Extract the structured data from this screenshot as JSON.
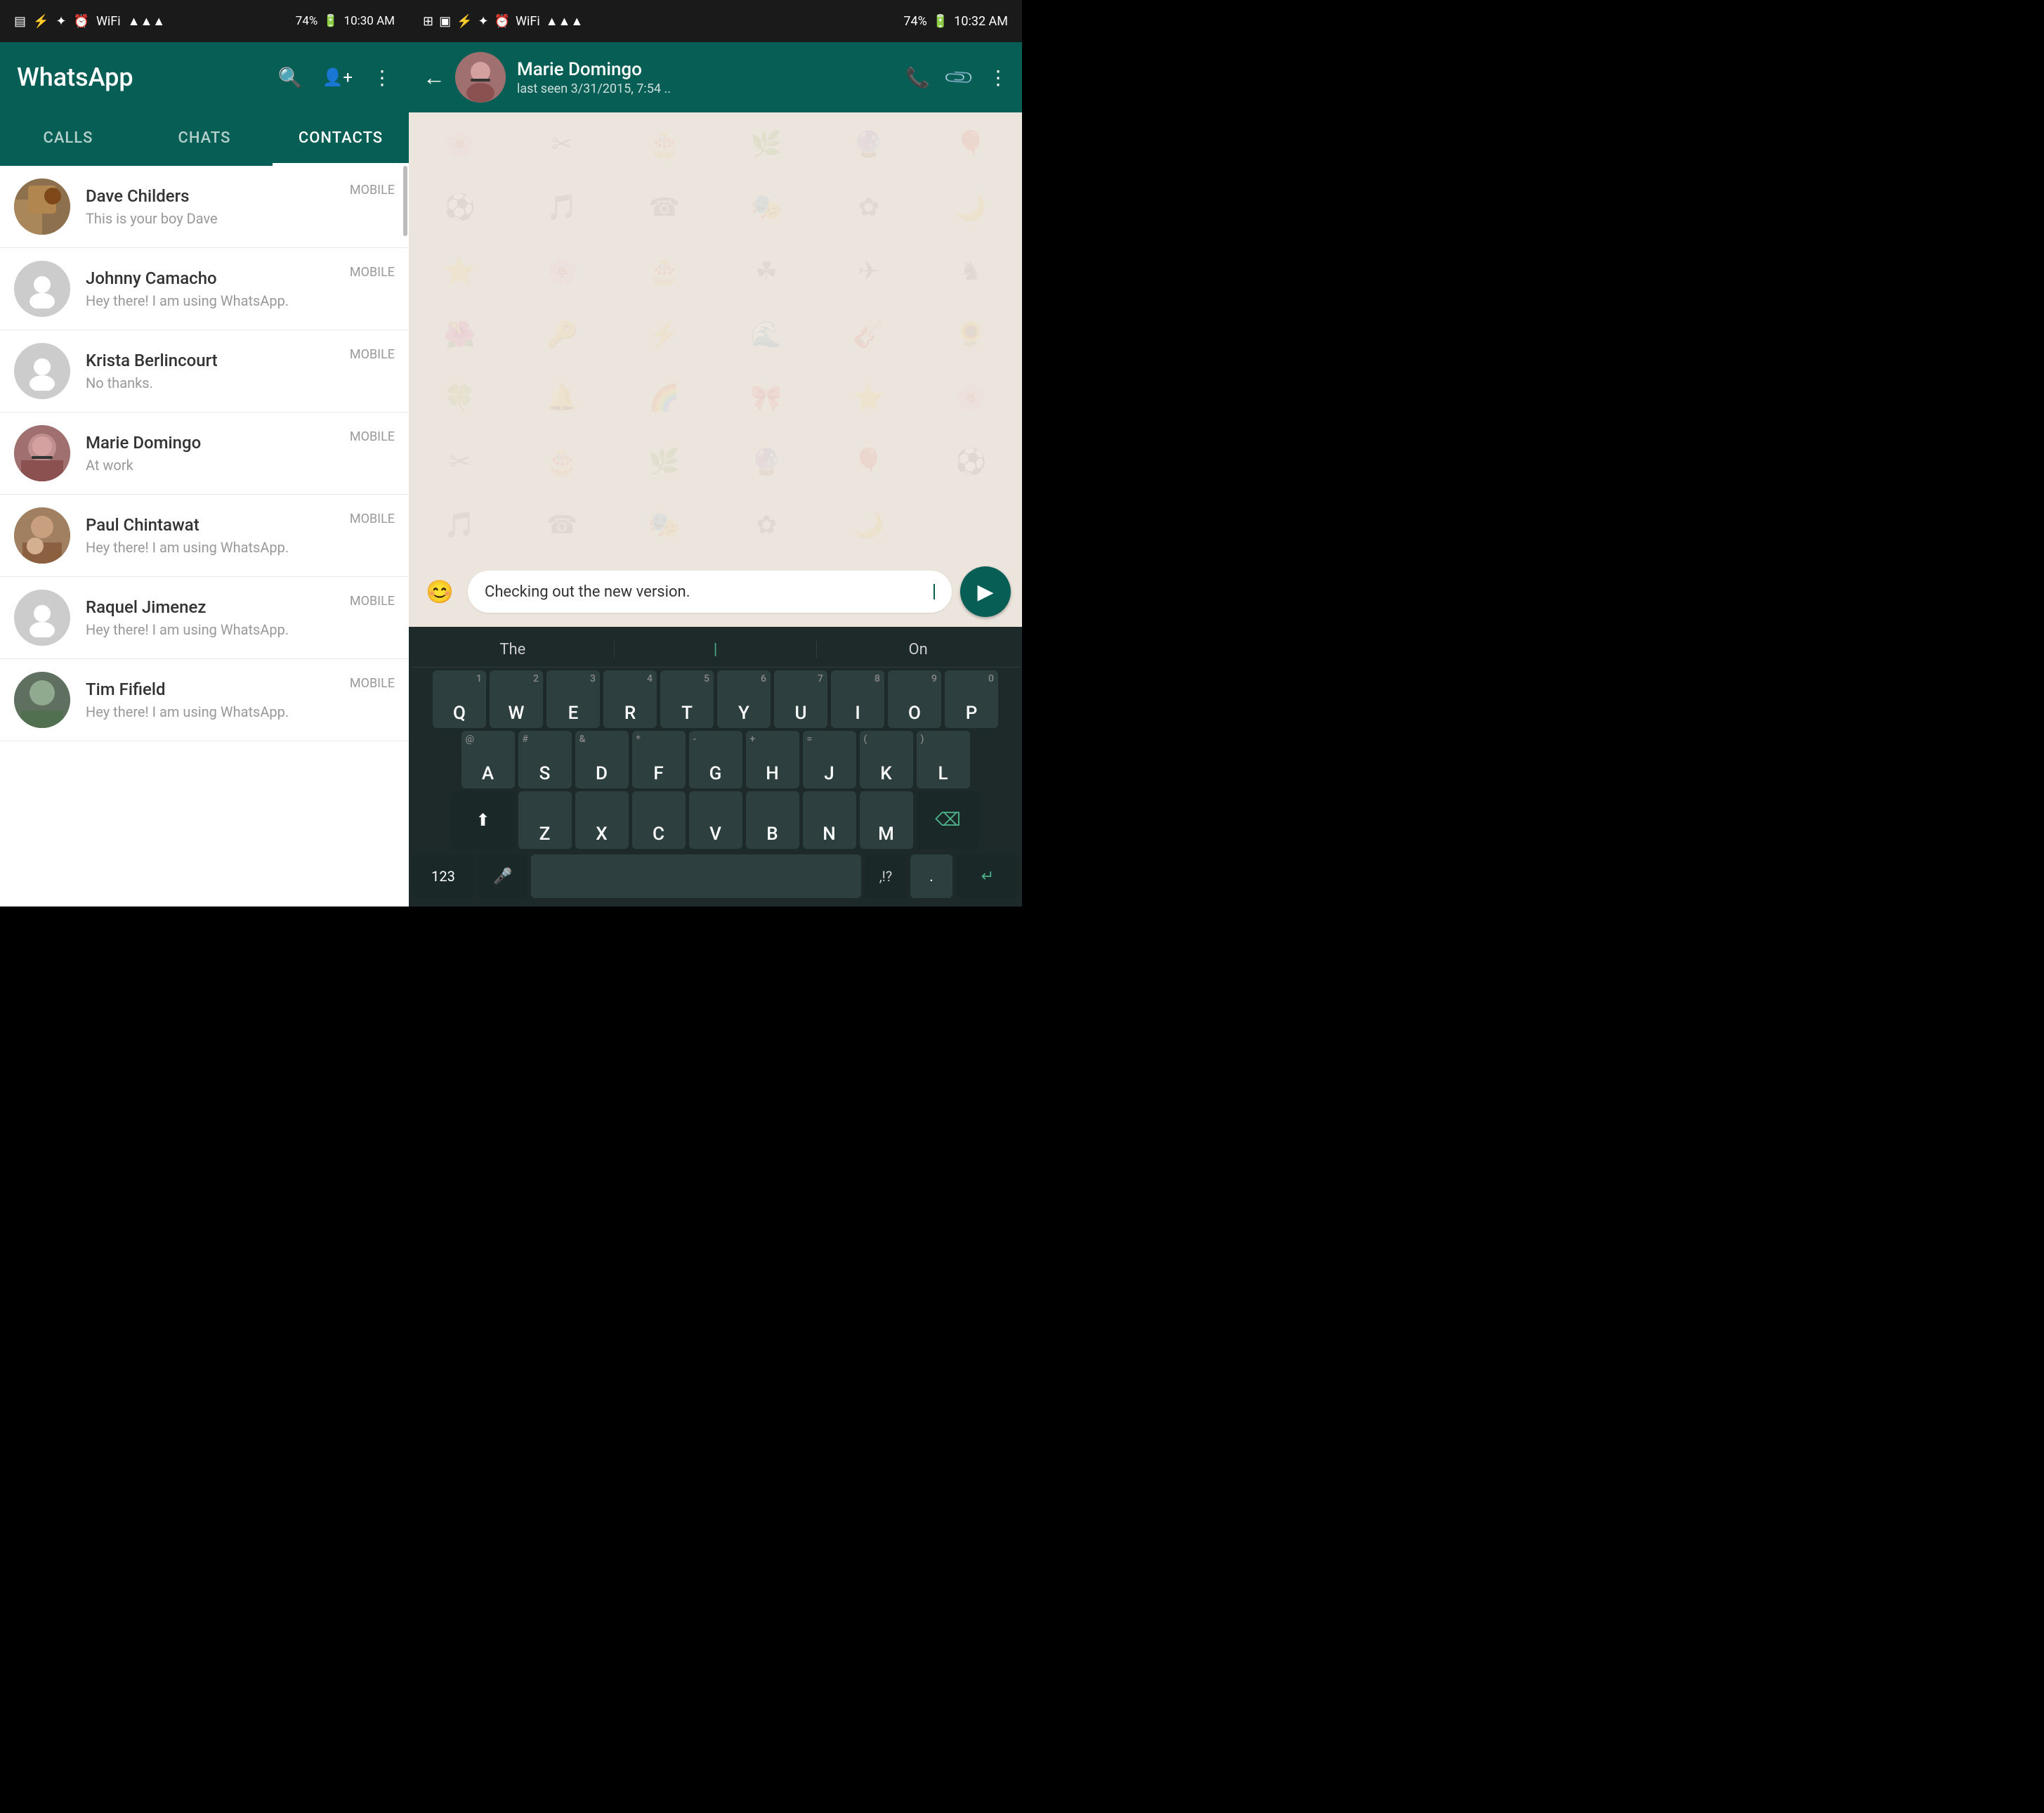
{
  "left": {
    "statusBar": {
      "time": "10:30 AM",
      "battery": "74%"
    },
    "header": {
      "title": "WhatsApp",
      "searchIcon": "🔍",
      "addContactIcon": "👤+",
      "menuIcon": "⋮"
    },
    "tabs": [
      {
        "id": "calls",
        "label": "CALLS",
        "active": false
      },
      {
        "id": "chats",
        "label": "CHATS",
        "active": false
      },
      {
        "id": "contacts",
        "label": "CONTACTS",
        "active": true
      }
    ],
    "contacts": [
      {
        "id": "dave",
        "name": "Dave Childers",
        "status": "This is your boy Dave",
        "type": "MOBILE",
        "hasPhoto": true
      },
      {
        "id": "johnny",
        "name": "Johnny Camacho",
        "status": "Hey there! I am using WhatsApp.",
        "type": "MOBILE",
        "hasPhoto": false
      },
      {
        "id": "krista",
        "name": "Krista Berlincourt",
        "status": "No thanks.",
        "type": "MOBILE",
        "hasPhoto": false
      },
      {
        "id": "marie",
        "name": "Marie Domingo",
        "status": "At work",
        "type": "MOBILE",
        "hasPhoto": true
      },
      {
        "id": "paul",
        "name": "Paul Chintawat",
        "status": "Hey there! I am using WhatsApp.",
        "type": "MOBILE",
        "hasPhoto": true
      },
      {
        "id": "raquel",
        "name": "Raquel Jimenez",
        "status": "Hey there! I am using WhatsApp.",
        "type": "MOBILE",
        "hasPhoto": false
      },
      {
        "id": "tim",
        "name": "Tim Fifield",
        "status": "Hey there! I am using WhatsApp.",
        "type": "MOBILE",
        "hasPhoto": true
      }
    ]
  },
  "right": {
    "statusBar": {
      "time": "10:32 AM",
      "battery": "74%"
    },
    "header": {
      "backIcon": "←",
      "contactName": "Marie Domingo",
      "lastSeen": "last seen 3/31/2015, 7:54 ..",
      "callIcon": "📞",
      "attachIcon": "📎",
      "menuIcon": "⋮"
    },
    "messageInput": {
      "emojiIcon": "😊",
      "text": "Checking out the new version.",
      "sendIcon": "▶"
    },
    "keyboard": {
      "suggestions": [
        "The",
        "I",
        "On"
      ],
      "rows": [
        [
          "Q",
          "W",
          "E",
          "R",
          "T",
          "Y",
          "U",
          "I",
          "O",
          "P"
        ],
        [
          "A",
          "S",
          "D",
          "F",
          "G",
          "H",
          "J",
          "K",
          "L"
        ],
        [
          "Z",
          "X",
          "C",
          "V",
          "B",
          "N",
          "M"
        ]
      ],
      "numbers": [
        "1",
        "2",
        "3",
        "4",
        "5",
        "6",
        "7",
        "8",
        "9",
        "0"
      ],
      "symbols": [
        "@",
        "#",
        "&",
        "*",
        "-",
        "+",
        "=",
        "(",
        ")",
        ",",
        "\"",
        "'",
        "!",
        "?",
        "/"
      ],
      "numToggleLabel": "123",
      "commaLabel": ",",
      "periodLabel": ".",
      "emojiLabel": "😊"
    }
  }
}
